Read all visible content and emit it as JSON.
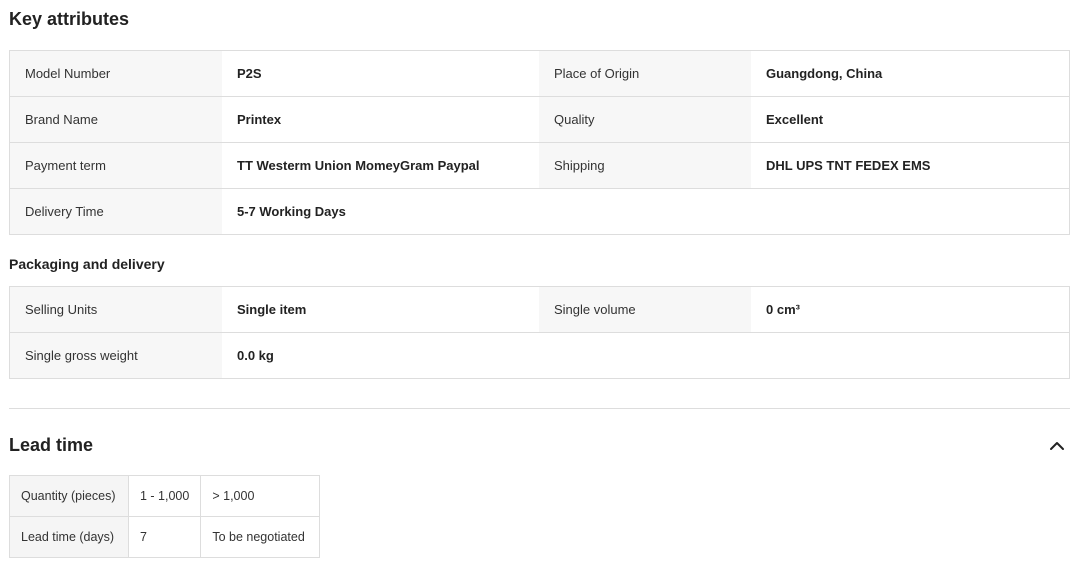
{
  "key_attributes": {
    "title": "Key attributes",
    "rows": [
      {
        "label1": "Model Number",
        "value1": "P2S",
        "label2": "Place of Origin",
        "value2": "Guangdong, China"
      },
      {
        "label1": "Brand Name",
        "value1": "Printex",
        "label2": "Quality",
        "value2": "Excellent"
      },
      {
        "label1": "Payment term",
        "value1": "TT Westerm Union MomeyGram Paypal",
        "label2": "Shipping",
        "value2": "DHL UPS TNT FEDEX EMS"
      },
      {
        "label1": "Delivery Time",
        "value1": "5-7 Working Days",
        "label2": "",
        "value2": ""
      }
    ]
  },
  "packaging": {
    "title": "Packaging and delivery",
    "rows": [
      {
        "label1": "Selling Units",
        "value1": "Single item",
        "label2": "Single volume",
        "value2": "0 cm³"
      },
      {
        "label1": "Single gross weight",
        "value1": "0.0 kg",
        "label2": "",
        "value2": ""
      }
    ]
  },
  "lead_time": {
    "title": "Lead time",
    "toggle_icon": "chevron-up-icon",
    "quantity_header": "Quantity (pieces)",
    "lead_header": "Lead time (days)",
    "columns": [
      {
        "quantity": "1 - 1,000",
        "days": "7"
      },
      {
        "quantity": "> 1,000",
        "days": "To be negotiated"
      }
    ]
  }
}
